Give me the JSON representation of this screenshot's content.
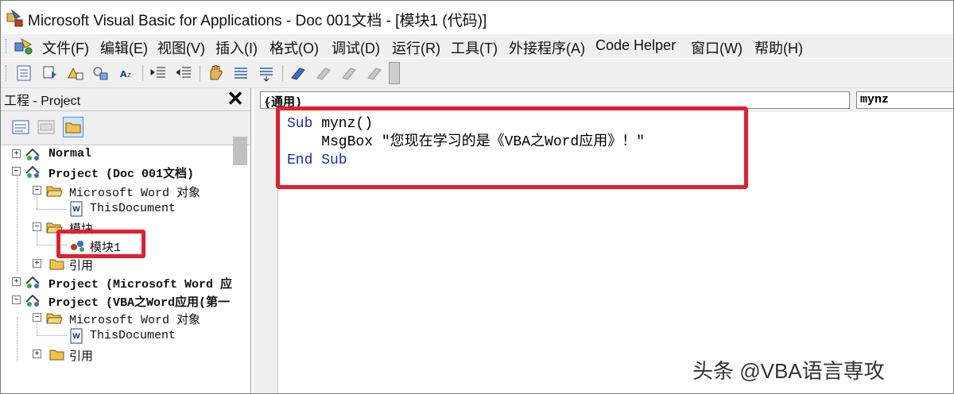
{
  "window": {
    "title": "Microsoft Visual Basic for Applications - Doc 001文档 - [模块1 (代码)]"
  },
  "menu": {
    "items": [
      "文件(F)",
      "编辑(E)",
      "视图(V)",
      "插入(I)",
      "格式(O)",
      "调试(D)",
      "运行(R)",
      "工具(T)",
      "外接程序(A)",
      "Code Helper",
      "窗口(W)",
      "帮助(H)"
    ]
  },
  "project_pane": {
    "title": "工程 - Project",
    "tree": [
      {
        "label": "Normal",
        "bold": true
      },
      {
        "label": "Project (Doc 001文档)",
        "bold": true
      },
      {
        "label": "Microsoft Word 对象",
        "bold": false
      },
      {
        "label": "ThisDocument",
        "bold": false
      },
      {
        "label": "模块",
        "bold": false
      },
      {
        "label": "模块1",
        "bold": false
      },
      {
        "label": "引用",
        "bold": false
      },
      {
        "label": "Project (Microsoft Word 应",
        "bold": true
      },
      {
        "label": "Project (VBA之Word应用(第一",
        "bold": true
      },
      {
        "label": "Microsoft Word 对象",
        "bold": false
      },
      {
        "label": "ThisDocument",
        "bold": false
      },
      {
        "label": "引用",
        "bold": false
      }
    ]
  },
  "code_pane": {
    "object_combo": "(通用)",
    "proc_combo": "mynz",
    "lines": [
      {
        "kw": "Sub",
        "rest": " mynz()"
      },
      {
        "kw": "",
        "rest": "    MsgBox \"您现在学习的是《VBA之Word应用》！\""
      },
      {
        "kw": "End Sub",
        "rest": ""
      }
    ]
  },
  "watermark": "头条 @VBA语言専攻",
  "colors": {
    "highlight": "#e0202e",
    "keyword": "#1a2fb0"
  }
}
